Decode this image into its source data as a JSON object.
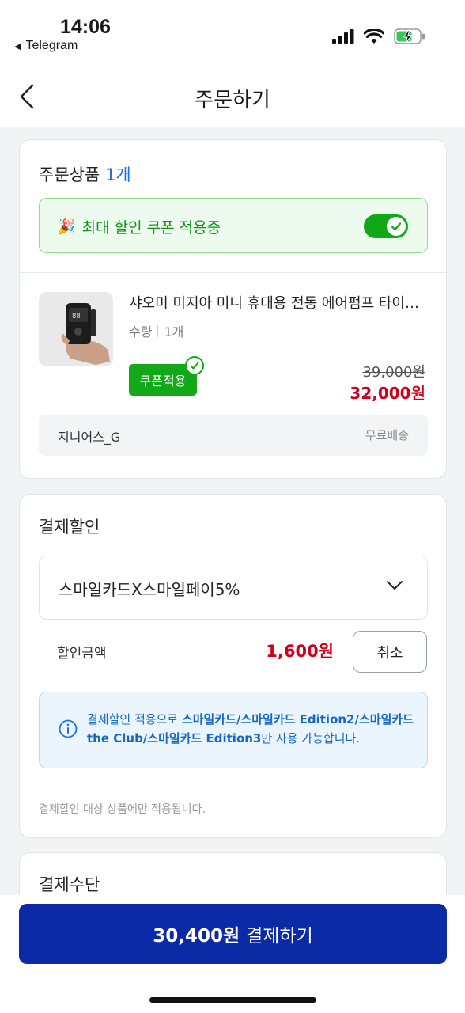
{
  "status_bar": {
    "time": "14:06",
    "back_app": "Telegram",
    "icons": [
      "cellular-signal-icon",
      "wifi-icon",
      "battery-charging-icon"
    ]
  },
  "header": {
    "title": "주문하기",
    "back_icon": "chevron-left-icon"
  },
  "order_items": {
    "title": "주문상품",
    "count": "1개",
    "coupon_banner": {
      "emoji": "🎉",
      "text": "최대 할인 쿠폰 적용중",
      "toggle_on": true
    },
    "product": {
      "name": "샤오미 미지아 미니 휴대용 전동 에어펌프 타이어 공기주입기",
      "qty_label": "수량",
      "qty": "1개",
      "coupon_tag": "쿠폰적용",
      "original_price": "39,000원",
      "sale_price": "32,000원"
    },
    "seller": {
      "name": "지니어스_G",
      "shipping": "무료배송"
    }
  },
  "payment_discount": {
    "title": "결제할인",
    "selected_card": "스마일카드X스마일페이5%",
    "discount_label": "할인금액",
    "discount_amount": "1,600원",
    "cancel_label": "취소",
    "info": {
      "prefix": "결제할인 적용으로 ",
      "highlight": "스마일카드/스마일카드 Edition2/스마일카드 the Club/스마일카드 Edition3",
      "suffix": "만 사용 가능합니다."
    },
    "footnote": "결제할인 대상 상품에만 적용됩니다."
  },
  "payment_method": {
    "title": "결제수단"
  },
  "pay_button": {
    "amount": "30,400원",
    "label": "결제하기"
  },
  "colors": {
    "accent_blue": "#0a2aa6",
    "price_red": "#d0021b",
    "coupon_green": "#12a818",
    "info_blue": "#1668c4"
  }
}
